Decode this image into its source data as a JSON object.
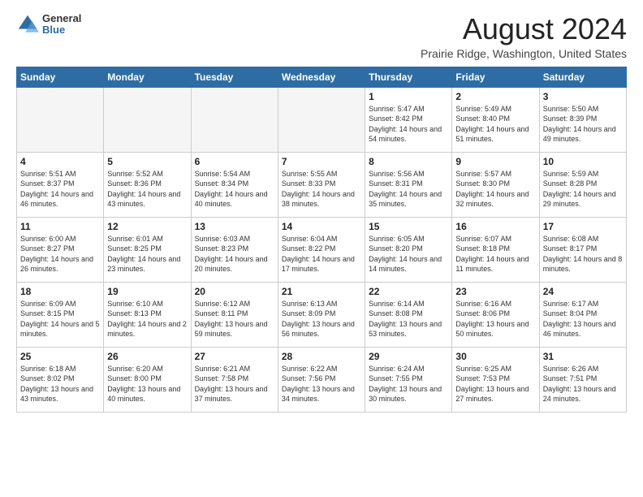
{
  "logo": {
    "general": "General",
    "blue": "Blue"
  },
  "title": "August 2024",
  "location": "Prairie Ridge, Washington, United States",
  "weekdays": [
    "Sunday",
    "Monday",
    "Tuesday",
    "Wednesday",
    "Thursday",
    "Friday",
    "Saturday"
  ],
  "weeks": [
    [
      {
        "day": "",
        "empty": true
      },
      {
        "day": "",
        "empty": true
      },
      {
        "day": "",
        "empty": true
      },
      {
        "day": "",
        "empty": true
      },
      {
        "day": "1",
        "sunrise": "5:47 AM",
        "sunset": "8:42 PM",
        "daylight": "14 hours and 54 minutes."
      },
      {
        "day": "2",
        "sunrise": "5:49 AM",
        "sunset": "8:40 PM",
        "daylight": "14 hours and 51 minutes."
      },
      {
        "day": "3",
        "sunrise": "5:50 AM",
        "sunset": "8:39 PM",
        "daylight": "14 hours and 49 minutes."
      }
    ],
    [
      {
        "day": "4",
        "sunrise": "5:51 AM",
        "sunset": "8:37 PM",
        "daylight": "14 hours and 46 minutes."
      },
      {
        "day": "5",
        "sunrise": "5:52 AM",
        "sunset": "8:36 PM",
        "daylight": "14 hours and 43 minutes."
      },
      {
        "day": "6",
        "sunrise": "5:54 AM",
        "sunset": "8:34 PM",
        "daylight": "14 hours and 40 minutes."
      },
      {
        "day": "7",
        "sunrise": "5:55 AM",
        "sunset": "8:33 PM",
        "daylight": "14 hours and 38 minutes."
      },
      {
        "day": "8",
        "sunrise": "5:56 AM",
        "sunset": "8:31 PM",
        "daylight": "14 hours and 35 minutes."
      },
      {
        "day": "9",
        "sunrise": "5:57 AM",
        "sunset": "8:30 PM",
        "daylight": "14 hours and 32 minutes."
      },
      {
        "day": "10",
        "sunrise": "5:59 AM",
        "sunset": "8:28 PM",
        "daylight": "14 hours and 29 minutes."
      }
    ],
    [
      {
        "day": "11",
        "sunrise": "6:00 AM",
        "sunset": "8:27 PM",
        "daylight": "14 hours and 26 minutes."
      },
      {
        "day": "12",
        "sunrise": "6:01 AM",
        "sunset": "8:25 PM",
        "daylight": "14 hours and 23 minutes."
      },
      {
        "day": "13",
        "sunrise": "6:03 AM",
        "sunset": "8:23 PM",
        "daylight": "14 hours and 20 minutes."
      },
      {
        "day": "14",
        "sunrise": "6:04 AM",
        "sunset": "8:22 PM",
        "daylight": "14 hours and 17 minutes."
      },
      {
        "day": "15",
        "sunrise": "6:05 AM",
        "sunset": "8:20 PM",
        "daylight": "14 hours and 14 minutes."
      },
      {
        "day": "16",
        "sunrise": "6:07 AM",
        "sunset": "8:18 PM",
        "daylight": "14 hours and 11 minutes."
      },
      {
        "day": "17",
        "sunrise": "6:08 AM",
        "sunset": "8:17 PM",
        "daylight": "14 hours and 8 minutes."
      }
    ],
    [
      {
        "day": "18",
        "sunrise": "6:09 AM",
        "sunset": "8:15 PM",
        "daylight": "14 hours and 5 minutes."
      },
      {
        "day": "19",
        "sunrise": "6:10 AM",
        "sunset": "8:13 PM",
        "daylight": "14 hours and 2 minutes."
      },
      {
        "day": "20",
        "sunrise": "6:12 AM",
        "sunset": "8:11 PM",
        "daylight": "13 hours and 59 minutes."
      },
      {
        "day": "21",
        "sunrise": "6:13 AM",
        "sunset": "8:09 PM",
        "daylight": "13 hours and 56 minutes."
      },
      {
        "day": "22",
        "sunrise": "6:14 AM",
        "sunset": "8:08 PM",
        "daylight": "13 hours and 53 minutes."
      },
      {
        "day": "23",
        "sunrise": "6:16 AM",
        "sunset": "8:06 PM",
        "daylight": "13 hours and 50 minutes."
      },
      {
        "day": "24",
        "sunrise": "6:17 AM",
        "sunset": "8:04 PM",
        "daylight": "13 hours and 46 minutes."
      }
    ],
    [
      {
        "day": "25",
        "sunrise": "6:18 AM",
        "sunset": "8:02 PM",
        "daylight": "13 hours and 43 minutes."
      },
      {
        "day": "26",
        "sunrise": "6:20 AM",
        "sunset": "8:00 PM",
        "daylight": "13 hours and 40 minutes."
      },
      {
        "day": "27",
        "sunrise": "6:21 AM",
        "sunset": "7:58 PM",
        "daylight": "13 hours and 37 minutes."
      },
      {
        "day": "28",
        "sunrise": "6:22 AM",
        "sunset": "7:56 PM",
        "daylight": "13 hours and 34 minutes."
      },
      {
        "day": "29",
        "sunrise": "6:24 AM",
        "sunset": "7:55 PM",
        "daylight": "13 hours and 30 minutes."
      },
      {
        "day": "30",
        "sunrise": "6:25 AM",
        "sunset": "7:53 PM",
        "daylight": "13 hours and 27 minutes."
      },
      {
        "day": "31",
        "sunrise": "6:26 AM",
        "sunset": "7:51 PM",
        "daylight": "13 hours and 24 minutes."
      }
    ]
  ]
}
